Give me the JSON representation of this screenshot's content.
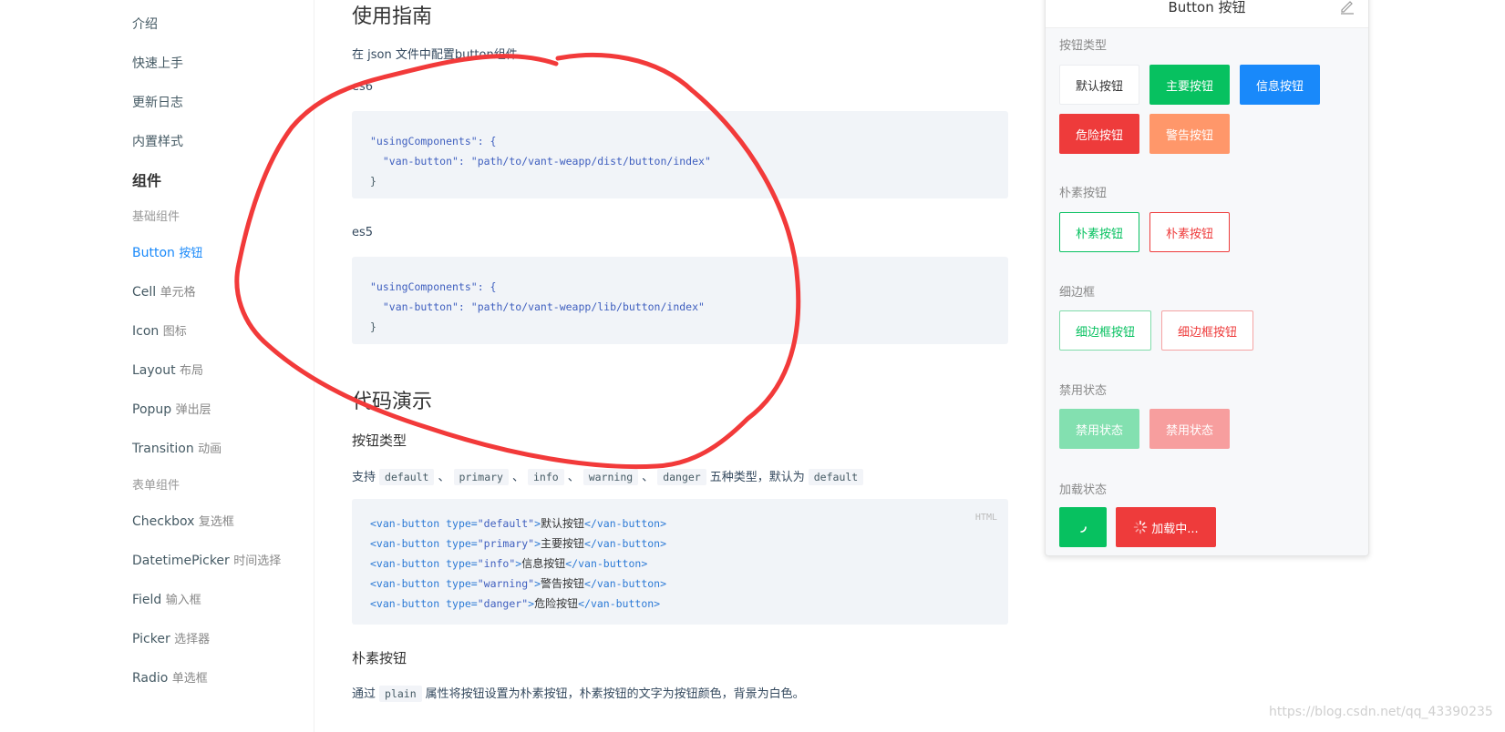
{
  "sidebar": {
    "items": [
      {
        "label": "介绍",
        "cn": ""
      },
      {
        "label": "快速上手",
        "cn": ""
      },
      {
        "label": "更新日志",
        "cn": ""
      },
      {
        "label": "内置样式",
        "cn": ""
      }
    ],
    "group_title": "组件",
    "subgroup_basic": "基础组件",
    "basic_items": [
      {
        "label": "Button",
        "cn": "按钮"
      },
      {
        "label": "Cell",
        "cn": "单元格"
      },
      {
        "label": "Icon",
        "cn": "图标"
      },
      {
        "label": "Layout",
        "cn": "布局"
      },
      {
        "label": "Popup",
        "cn": "弹出层"
      },
      {
        "label": "Transition",
        "cn": "动画"
      }
    ],
    "subgroup_form": "表单组件",
    "form_items": [
      {
        "label": "Checkbox",
        "cn": "复选框"
      },
      {
        "label": "DatetimePicker",
        "cn": "时间选择"
      },
      {
        "label": "Field",
        "cn": "输入框"
      },
      {
        "label": "Picker",
        "cn": "选择器"
      },
      {
        "label": "Radio",
        "cn": "单选框"
      }
    ]
  },
  "doc": {
    "usage_title": "使用指南",
    "usage_text": "在 json 文件中配置button组件",
    "es6_label": "es6",
    "es6_code": [
      "\"usingComponents\": {",
      "  \"van-button\": \"path/to/vant-weapp/dist/button/index\"",
      "}"
    ],
    "es5_label": "es5",
    "es5_code": [
      "\"usingComponents\": {",
      "  \"van-button\": \"path/to/vant-weapp/lib/button/index\"",
      "}"
    ],
    "demo_title": "代码演示",
    "type_title": "按钮类型",
    "type_text_prefix": "支持",
    "type_codes": [
      "default",
      "primary",
      "info",
      "warning",
      "danger"
    ],
    "type_text_mid": "五种类型，默认为",
    "type_default": "default",
    "html_badge": "HTML",
    "html_lines": [
      {
        "type": "default",
        "text": "默认按钮"
      },
      {
        "type": "primary",
        "text": "主要按钮"
      },
      {
        "type": "info",
        "text": "信息按钮"
      },
      {
        "type": "warning",
        "text": "警告按钮"
      },
      {
        "type": "danger",
        "text": "危险按钮"
      }
    ],
    "plain_title": "朴素按钮",
    "plain_text_prefix": "通过",
    "plain_code": "plain",
    "plain_text_rest": "属性将按钮设置为朴素按钮，朴素按钮的文字为按钮颜色，背景为白色。"
  },
  "simulator": {
    "title": "Button 按钮",
    "sec_type": "按钮类型",
    "btn_default": "默认按钮",
    "btn_primary": "主要按钮",
    "btn_info": "信息按钮",
    "btn_danger": "危险按钮",
    "btn_warning": "警告按钮",
    "sec_plain": "朴素按钮",
    "btn_plain_primary": "朴素按钮",
    "btn_plain_danger": "朴素按钮",
    "sec_hairline": "细边框",
    "btn_hair_primary": "细边框按钮",
    "btn_hair_danger": "细边框按钮",
    "sec_disabled": "禁用状态",
    "btn_dis_primary": "禁用状态",
    "btn_dis_danger": "禁用状态",
    "sec_loading": "加载状态",
    "btn_loading_text": "加载中..."
  },
  "watermark": "https://blog.csdn.net/qq_43390235",
  "colors": {
    "primary": "#07c160",
    "info": "#1989fa",
    "danger": "#ee3b3b",
    "warning": "#ff976a",
    "annotation": "#f23a3a"
  }
}
